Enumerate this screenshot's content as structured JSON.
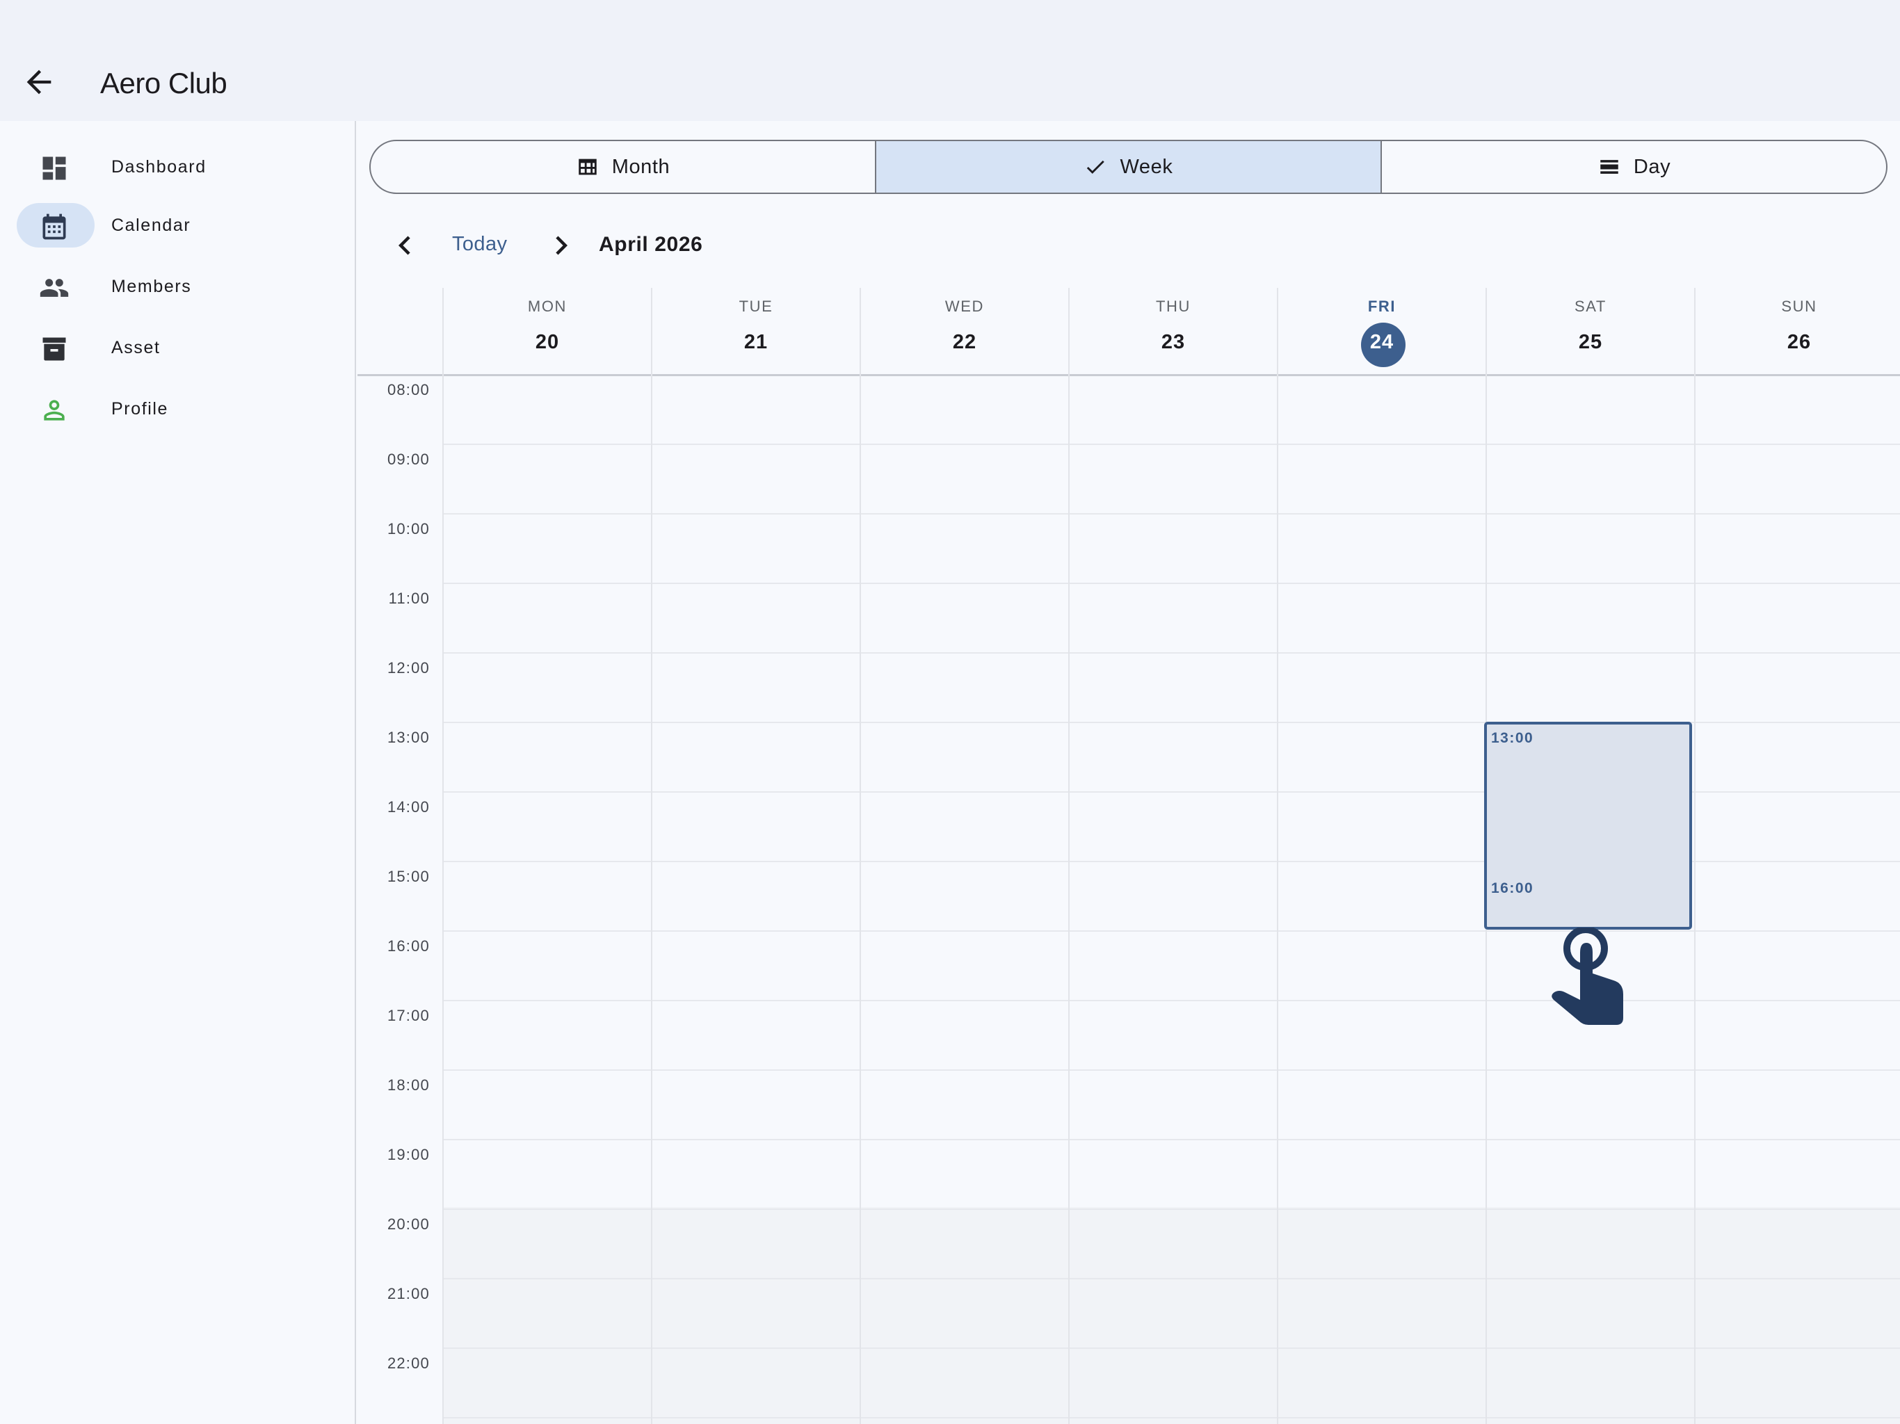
{
  "app": {
    "title": "Aero Club"
  },
  "sidebar": {
    "items": [
      {
        "label": "Dashboard",
        "icon": "dashboard-icon",
        "active": false
      },
      {
        "label": "Calendar",
        "icon": "calendar-icon",
        "active": true
      },
      {
        "label": "Members",
        "icon": "group-icon",
        "active": false
      },
      {
        "label": "Asset",
        "icon": "archive-icon",
        "active": false
      },
      {
        "label": "Profile",
        "icon": "person-icon",
        "active": false
      }
    ]
  },
  "view_switch": {
    "options": [
      {
        "label": "Month",
        "icon": "grid-table-icon",
        "selected": false
      },
      {
        "label": "Week",
        "icon": "check-icon",
        "selected": true
      },
      {
        "label": "Day",
        "icon": "day-view-icon",
        "selected": false
      }
    ]
  },
  "calendar_nav": {
    "today_label": "Today",
    "period_label": "April 2026"
  },
  "week": {
    "days": [
      {
        "dow": "MON",
        "date": "20",
        "today": false
      },
      {
        "dow": "TUE",
        "date": "21",
        "today": false
      },
      {
        "dow": "WED",
        "date": "22",
        "today": false
      },
      {
        "dow": "THU",
        "date": "23",
        "today": false
      },
      {
        "dow": "FRI",
        "date": "24",
        "today": true
      },
      {
        "dow": "SAT",
        "date": "25",
        "today": false
      },
      {
        "dow": "SUN",
        "date": "26",
        "today": false
      }
    ],
    "hours": [
      "08:00",
      "09:00",
      "10:00",
      "11:00",
      "12:00",
      "13:00",
      "14:00",
      "15:00",
      "16:00",
      "17:00",
      "18:00",
      "19:00",
      "20:00",
      "21:00",
      "22:00"
    ]
  },
  "selection": {
    "day": "SAT",
    "start": "13:00",
    "end": "16:00"
  },
  "colors": {
    "accent": "#3d5f8e",
    "selected_bg": "#d6e3f5",
    "profile_icon": "#4caf50"
  }
}
